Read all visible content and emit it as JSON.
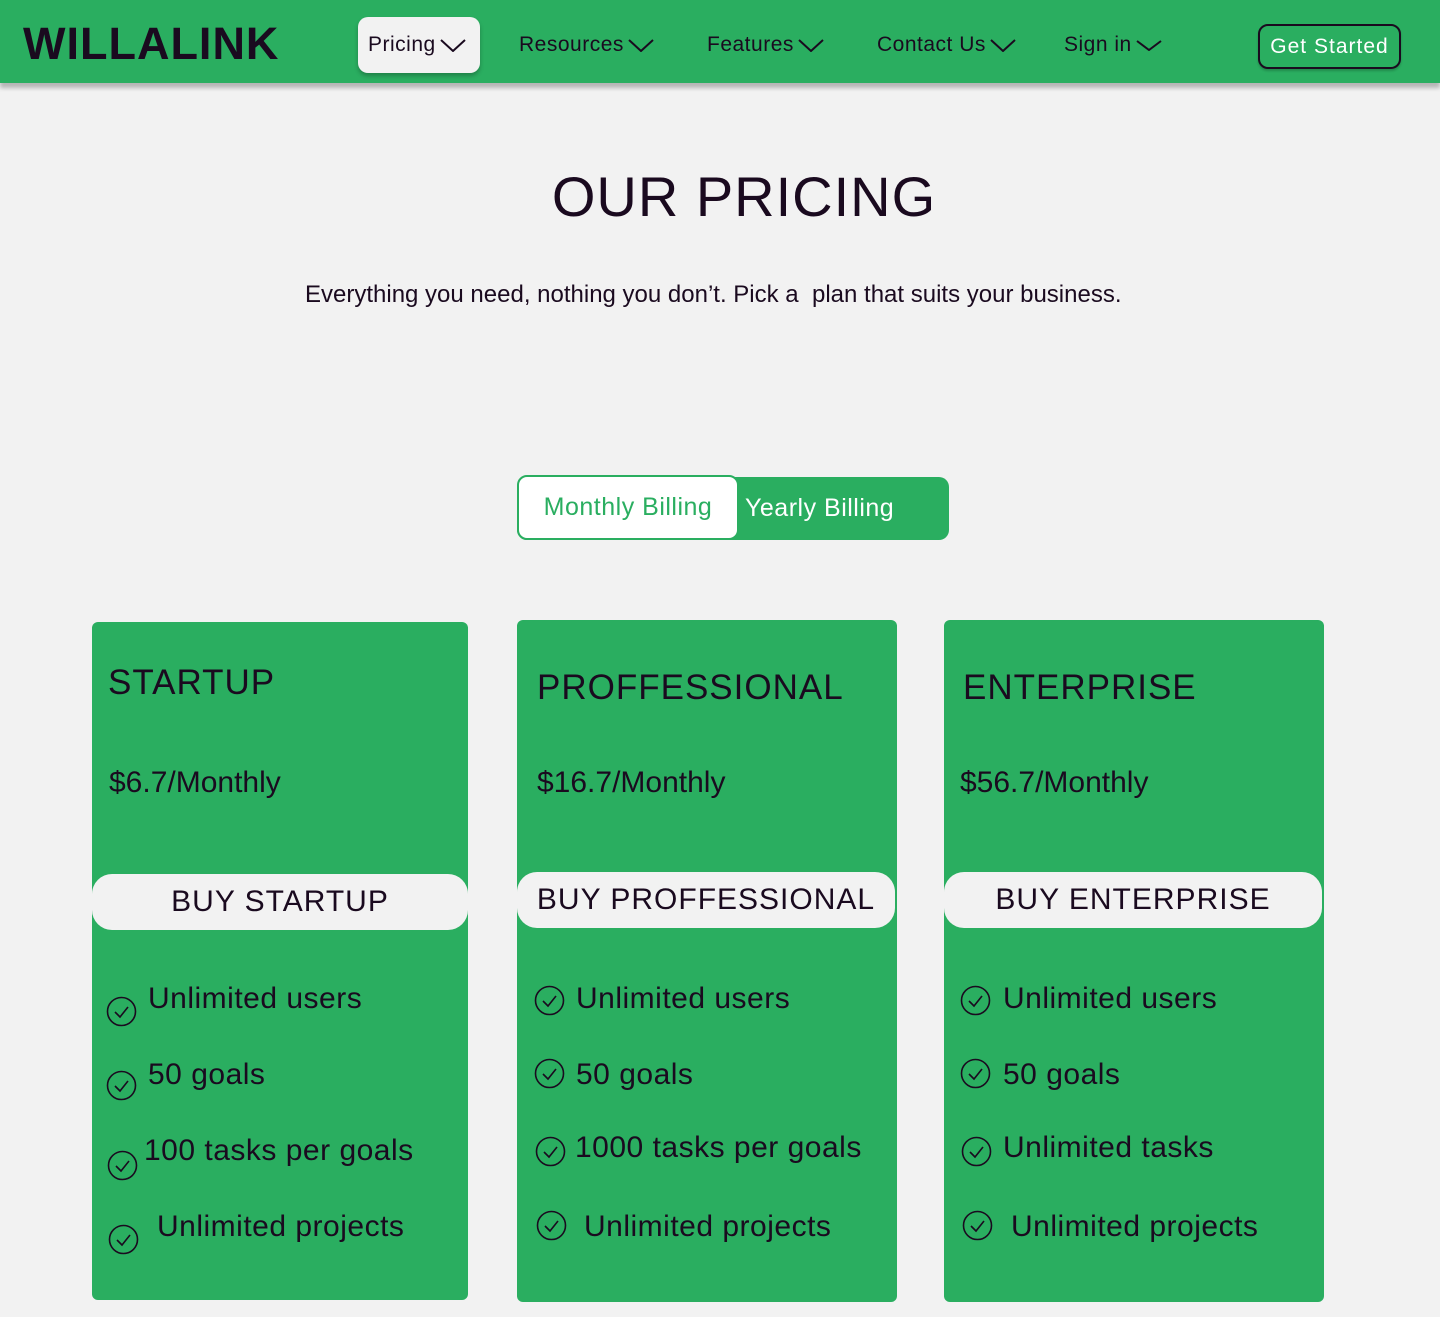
{
  "header": {
    "logo": "WILLALINK",
    "nav": [
      {
        "label": "Pricing",
        "active": true
      },
      {
        "label": "Resources"
      },
      {
        "label": "Features"
      },
      {
        "label": "Contact Us"
      },
      {
        "label": "Sign in"
      }
    ],
    "cta_label": "Get Started"
  },
  "hero": {
    "title": "OUR PRICING",
    "subtitle": "Everything you need, nothing you don’t. Pick a  plan that suits your business."
  },
  "billing_toggle": {
    "selected": "Monthly Billing",
    "other": "Yearly Billing"
  },
  "plans": [
    {
      "name": "STARTUP",
      "price": "$6.7/Monthly",
      "button": "BUY STARTUP",
      "features": [
        "Unlimited users",
        "50 goals",
        "100 tasks per goals",
        "Unlimited projects"
      ]
    },
    {
      "name": "PROFFESSIONAL",
      "price": "$16.7/Monthly",
      "button": "BUY PROFFESSIONAL",
      "features": [
        "Unlimited users",
        "50 goals",
        "1000 tasks per goals",
        "Unlimited projects"
      ]
    },
    {
      "name": "ENTERPRISE",
      "price": "$56.7/Monthly",
      "button": "BUY ENTERPRISE",
      "features": [
        "Unlimited users",
        "50 goals",
        "Unlimited tasks",
        "Unlimited projects"
      ]
    }
  ],
  "colors": {
    "brand_green": "#2aae60",
    "text_dark": "#1a0a1f",
    "background": "#f2f2f2"
  },
  "icons": {
    "nav_dropdown": "chevron-down-icon",
    "feature_check": "check-circle-icon"
  }
}
